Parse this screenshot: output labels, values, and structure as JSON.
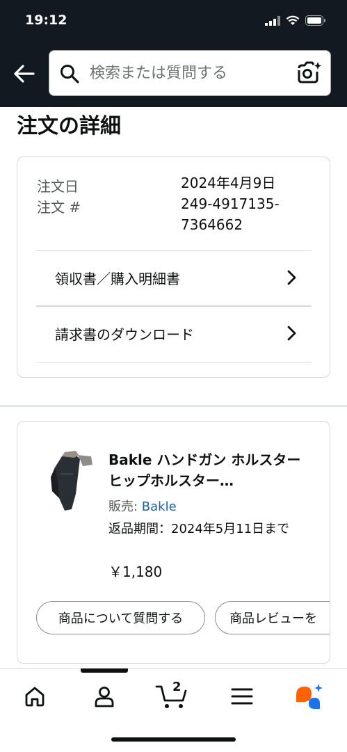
{
  "status_bar": {
    "time": "19:12"
  },
  "search": {
    "placeholder": "検索または質問する"
  },
  "page": {
    "title": "注文の詳細"
  },
  "order": {
    "date_label": "注文日",
    "date_value": "2024年4月9日",
    "number_label": "注文 #",
    "number_value": "249-4917135-7364662",
    "links": [
      {
        "label": "領収書／購入明細書"
      },
      {
        "label": "請求書のダウンロード"
      }
    ]
  },
  "item": {
    "title": "Bakle ハンドガン ホルスター ヒップホルスター…",
    "seller_label": "販売: ",
    "seller_name": "Bakle",
    "return_period": "返品期間：2024年5月11日まで",
    "price": "￥1,180",
    "actions": [
      {
        "label": "商品について質問する"
      },
      {
        "label": "商品レビューを"
      }
    ]
  },
  "tab_bar": {
    "cart_count": "2",
    "tabs": [
      "home-icon",
      "account-icon",
      "cart-icon",
      "menu-icon",
      "rufus-icon"
    ]
  },
  "colors": {
    "header_bg": "#131921",
    "link": "#2162a1",
    "border": "#d5d9d9"
  }
}
